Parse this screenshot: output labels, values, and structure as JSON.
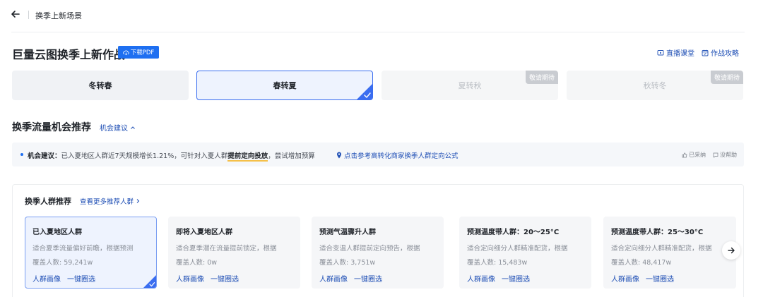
{
  "topbar": {
    "title": "换季上新场景"
  },
  "header": {
    "title": "巨量云图换季上新作战",
    "pdf_label": "下载PDF",
    "links": [
      {
        "label": "直播课堂",
        "icon": "live-class-icon"
      },
      {
        "label": "作战攻略",
        "icon": "strategy-icon"
      }
    ]
  },
  "seasons": [
    {
      "label": "冬转春",
      "state": "normal"
    },
    {
      "label": "春转夏",
      "state": "active"
    },
    {
      "label": "夏转秋",
      "state": "disabled",
      "badge": "敬请期待"
    },
    {
      "label": "秋转冬",
      "state": "disabled",
      "badge": "敬请期待"
    }
  ],
  "opportunity": {
    "title": "换季流量机会推荐",
    "toggle_label": "机会建议"
  },
  "advice": {
    "label": "机会建议：",
    "text_before": "已入夏地区人群近7天规模增长1.21%，可针对入夏人群",
    "highlight": "提前定向投放",
    "text_after": "，尝试增加预算",
    "link": "点击参考高转化商家换季人群定向公式",
    "adopted": "已采纳",
    "unhelpful": "没帮助"
  },
  "crowds": {
    "title": "换季人群推荐",
    "more_label": "查看更多推荐人群",
    "cards": [
      {
        "title": "已入夏地区人群",
        "desc": "适合夏季流量偏好前瞻，根据预测",
        "cover": "覆盖人数: 59,241w",
        "selected": true
      },
      {
        "title": "即将入夏地区人群",
        "desc": "适合夏季潜在流量提前锁定，根据",
        "cover": "覆盖人数: 0w",
        "selected": false
      },
      {
        "title": "预测气温骤升人群",
        "desc": "适合变温人群提前定向预告，根据",
        "cover": "覆盖人数: 3,751w",
        "selected": false
      },
      {
        "title": "预测温度带人群：20～25°C",
        "desc": "适合定向细分人群精准配货，根据",
        "cover": "覆盖人数: 15,483w",
        "selected": false
      },
      {
        "title": "预测温度带人群：25～30°C",
        "desc": "适合定向细分人群精准配货，根据",
        "cover": "覆盖人数: 48,417w",
        "selected": false
      }
    ],
    "action_portrait": "人群画像",
    "action_select": "一键圈选"
  },
  "colors": {
    "accent": "#1e6ff1",
    "link": "#1f4fb5",
    "highlight": "#f5c04a"
  }
}
